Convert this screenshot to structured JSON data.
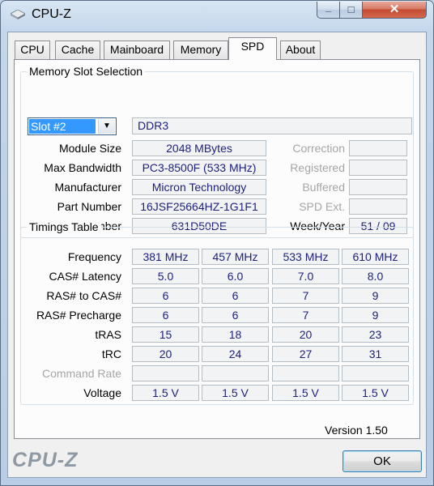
{
  "window": {
    "title": "CPU-Z",
    "min_icon": "minimize-icon",
    "max_icon": "maximize-icon",
    "close_icon": "close-icon"
  },
  "tabs": [
    "CPU",
    "Cache",
    "Mainboard",
    "Memory",
    "SPD",
    "About"
  ],
  "active_tab": "SPD",
  "slot": {
    "group_title": "Memory Slot Selection",
    "selected": "Slot #2",
    "type": "DDR3",
    "module_size_label": "Module Size",
    "module_size": "2048 MBytes",
    "max_bandwidth_label": "Max Bandwidth",
    "max_bandwidth": "PC3-8500F (533 MHz)",
    "manufacturer_label": "Manufacturer",
    "manufacturer": "Micron Technology",
    "part_number_label": "Part Number",
    "part_number": "16JSF25664HZ-1G1F1",
    "serial_number_label": "Serial Number",
    "serial_number": "631D50DE",
    "correction_label": "Correction",
    "correction": "",
    "registered_label": "Registered",
    "registered": "",
    "buffered_label": "Buffered",
    "buffered": "",
    "spd_ext_label": "SPD Ext.",
    "spd_ext": "",
    "week_year_label": "Week/Year",
    "week_year": "51 / 09"
  },
  "timings": {
    "group_title": "Timings Table",
    "rows": [
      {
        "label": "Frequency",
        "dim": false,
        "values": [
          "381 MHz",
          "457 MHz",
          "533 MHz",
          "610 MHz"
        ]
      },
      {
        "label": "CAS# Latency",
        "dim": false,
        "values": [
          "5.0",
          "6.0",
          "7.0",
          "8.0"
        ]
      },
      {
        "label": "RAS# to CAS#",
        "dim": false,
        "values": [
          "6",
          "6",
          "7",
          "9"
        ]
      },
      {
        "label": "RAS# Precharge",
        "dim": false,
        "values": [
          "6",
          "6",
          "7",
          "9"
        ]
      },
      {
        "label": "tRAS",
        "dim": false,
        "values": [
          "15",
          "18",
          "20",
          "23"
        ]
      },
      {
        "label": "tRC",
        "dim": false,
        "values": [
          "20",
          "24",
          "27",
          "31"
        ]
      },
      {
        "label": "Command Rate",
        "dim": true,
        "values": [
          "",
          "",
          "",
          ""
        ]
      },
      {
        "label": "Voltage",
        "dim": false,
        "values": [
          "1.5 V",
          "1.5 V",
          "1.5 V",
          "1.5 V"
        ]
      }
    ]
  },
  "version": "Version 1.50",
  "brand": "CPU-Z",
  "ok_label": "OK",
  "colors": {
    "value_text": "#1d1f7a",
    "dim_label": "#a6a6a6",
    "selection": "#3399ff"
  }
}
